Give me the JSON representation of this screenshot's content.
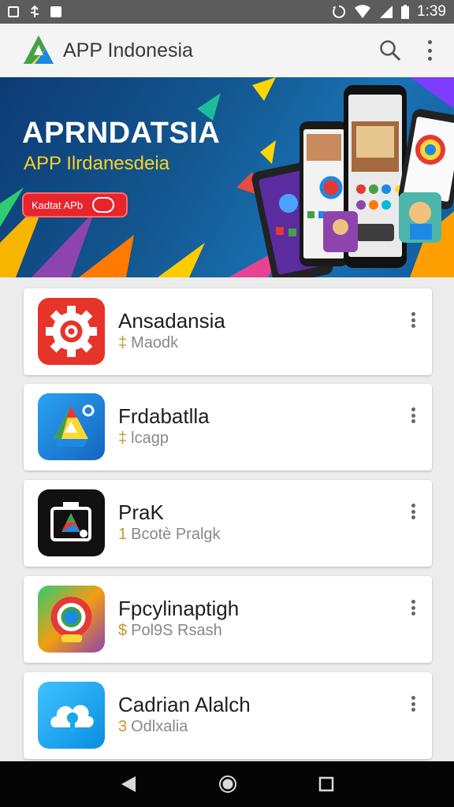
{
  "status_bar": {
    "time": "1:39"
  },
  "app_bar": {
    "title": "APP Indonesia",
    "accent_colors": [
      "#e53935",
      "#43a047",
      "#1e88e5",
      "#fdd835"
    ]
  },
  "banner": {
    "headline": "APRNDATSIA",
    "subheadline": "APP Ilrdanesdeia",
    "cta_label": "Kadtat APb"
  },
  "apps": [
    {
      "name": "Ansadansia",
      "sub_prefix": "‡",
      "subtitle": "Maodk",
      "icon": "gear-icon",
      "icon_color": "#e6342a"
    },
    {
      "name": "Frdabatlla",
      "sub_prefix": "‡",
      "subtitle": "lcagp",
      "icon": "drive-icon",
      "icon_color": "#1f8fd8"
    },
    {
      "name": "PraK",
      "sub_prefix": "1",
      "subtitle": "Bcotè Pralgk",
      "icon": "camera-icon",
      "icon_color": "#111111"
    },
    {
      "name": "Fpcylinaptigh",
      "sub_prefix": "$",
      "subtitle": "Pol9S Rsash",
      "icon": "chrome-icon",
      "icon_color": "#f39c12"
    },
    {
      "name": "Cadrian Alalch",
      "sub_prefix": "3",
      "subtitle": "Odlxalia",
      "icon": "cloud-key-icon",
      "icon_color": "#1aa8ee"
    }
  ]
}
